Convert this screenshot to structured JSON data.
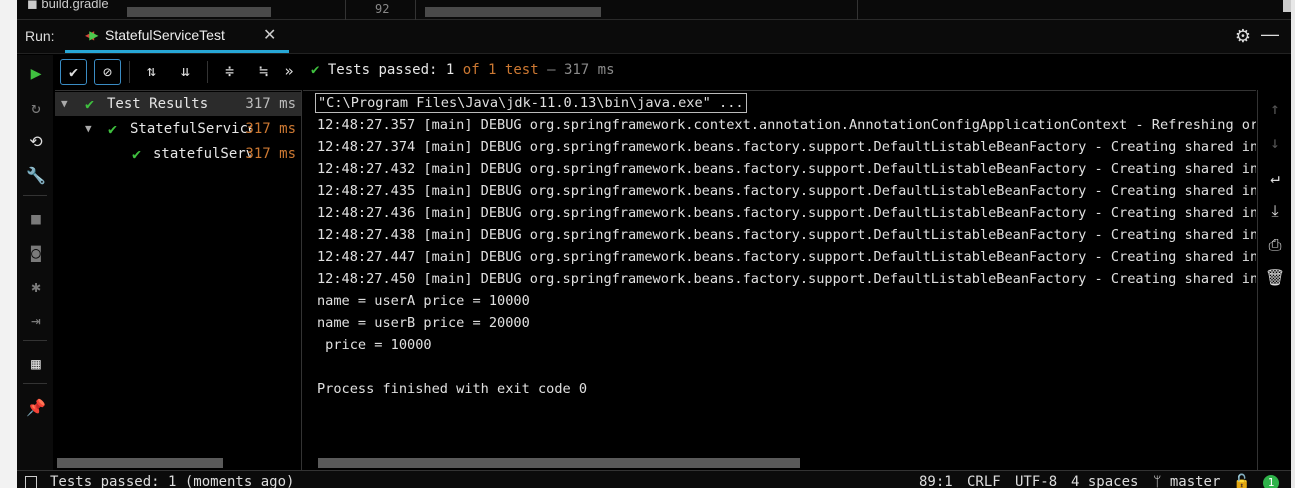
{
  "top_strip": {
    "file_name": "build.gradle",
    "line_number": "92"
  },
  "run_header": {
    "label": "Run:",
    "tab_title": "StatefulServiceTest",
    "close_glyph": "✕",
    "settings_glyph": "⚙",
    "minimize_glyph": "—"
  },
  "left_toolbar": {
    "icons": [
      "play-icon",
      "rerun-failed-icon",
      "toggle-auto-test-icon",
      "wrench-icon",
      "stop-icon",
      "camera-icon",
      "debug-icon",
      "exit-icon",
      "layout-icon",
      "pin-icon"
    ]
  },
  "test_toolbar": {
    "icons": [
      "show-passed-icon",
      "show-ignored-icon",
      "sort-alpha-icon",
      "sort-duration-icon",
      "expand-all-icon",
      "collapse-all-icon",
      "more-icon"
    ],
    "more_glyph": "»",
    "status_check": "✔",
    "status_prefix": "Tests passed:",
    "passed_count": "1",
    "of_total": "of 1 test",
    "dash": "–",
    "duration": "317 ms"
  },
  "tree": {
    "rows": [
      {
        "label": "Test Results",
        "time": "317 ms",
        "expanded": true
      },
      {
        "label": "StatefulService",
        "time": "317 ms",
        "expanded": true
      },
      {
        "label": "statefulServ",
        "time": "317 ms",
        "expanded": false
      }
    ]
  },
  "console": {
    "lines": [
      "\"C:\\Program Files\\Java\\jdk-11.0.13\\bin\\java.exe\" ...",
      "12:48:27.357 [main] DEBUG org.springframework.context.annotation.AnnotationConfigApplicationContext - Refreshing org.s",
      "12:48:27.374 [main] DEBUG org.springframework.beans.factory.support.DefaultListableBeanFactory - Creating shared insta",
      "12:48:27.432 [main] DEBUG org.springframework.beans.factory.support.DefaultListableBeanFactory - Creating shared insta",
      "12:48:27.435 [main] DEBUG org.springframework.beans.factory.support.DefaultListableBeanFactory - Creating shared insta",
      "12:48:27.436 [main] DEBUG org.springframework.beans.factory.support.DefaultListableBeanFactory - Creating shared insta",
      "12:48:27.438 [main] DEBUG org.springframework.beans.factory.support.DefaultListableBeanFactory - Creating shared insta",
      "12:48:27.447 [main] DEBUG org.springframework.beans.factory.support.DefaultListableBeanFactory - Creating shared insta",
      "12:48:27.450 [main] DEBUG org.springframework.beans.factory.support.DefaultListableBeanFactory - Creating shared insta",
      "name = userA price = 10000",
      "name = userB price = 20000",
      " price = 10000",
      "",
      "Process finished with exit code 0"
    ]
  },
  "right_toolbar": {
    "icons": [
      "up-arrow-icon",
      "down-arrow-icon",
      "soft-wrap-icon",
      "scroll-to-end-icon",
      "print-icon",
      "trash-icon"
    ]
  },
  "status_bar": {
    "message": "Tests passed: 1 (moments ago)",
    "position": "89:1",
    "line_sep": "CRLF",
    "encoding": "UTF-8",
    "indent": "4 spaces",
    "branch": "master",
    "notifications": "1"
  },
  "colors": {
    "accent_blue": "#27a7d6",
    "pass_green": "#3fc13f",
    "duration_orange": "#cc7832"
  }
}
